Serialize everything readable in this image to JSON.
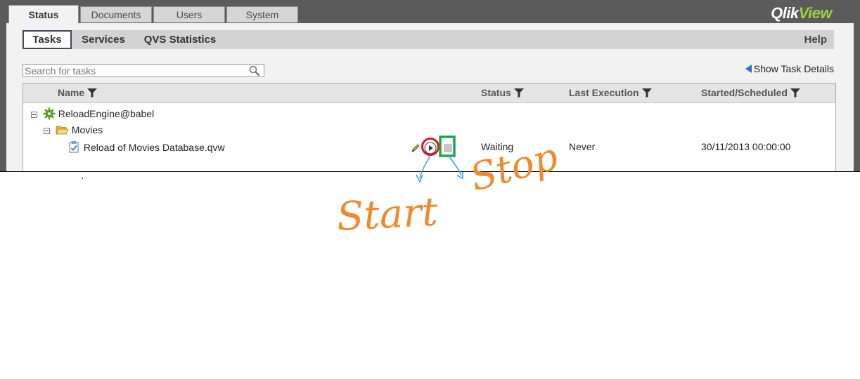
{
  "app": {
    "logo_main": "Qlik",
    "logo_sub": "View"
  },
  "top_tabs": [
    {
      "label": "Status",
      "active": true
    },
    {
      "label": "Documents",
      "active": false
    },
    {
      "label": "Users",
      "active": false
    },
    {
      "label": "System",
      "active": false
    }
  ],
  "sub_tabs": [
    {
      "label": "Tasks",
      "active": true
    },
    {
      "label": "Services",
      "active": false
    },
    {
      "label": "QVS Statistics",
      "active": false
    }
  ],
  "help_label": "Help",
  "search": {
    "placeholder": "Search for tasks"
  },
  "show_details_label": "Show Task Details",
  "columns": {
    "name": "Name",
    "status": "Status",
    "last_execution": "Last Execution",
    "started": "Started/Scheduled"
  },
  "tree": {
    "engine": "ReloadEngine@babel",
    "folder": "Movies",
    "task": {
      "name": "Reload of Movies Database.qvw",
      "status": "Waiting",
      "last_execution": "Never",
      "started": "30/11/2013 00:00:00"
    }
  },
  "annotations": {
    "start": "Start",
    "stop": "Stop"
  },
  "colors": {
    "start_circle": "#e0141e",
    "stop_box": "#1aa84a",
    "arrow": "#4aa0dd",
    "handwriting": "#f08a2c"
  }
}
